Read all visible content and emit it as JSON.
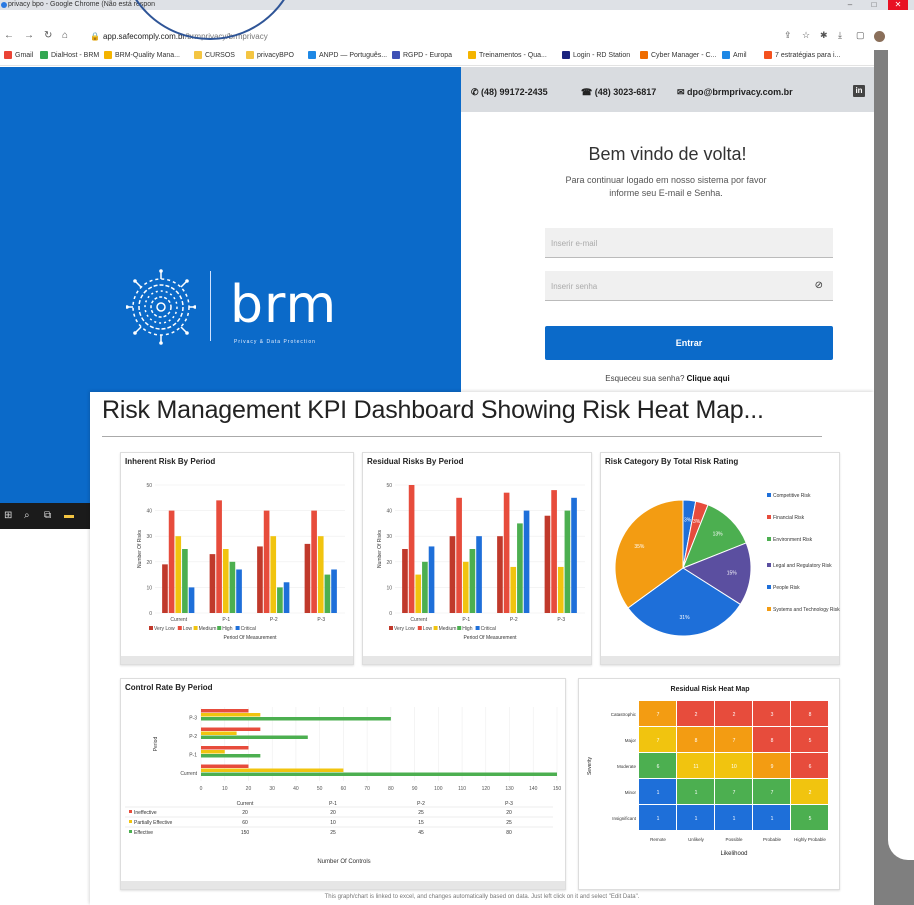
{
  "browser": {
    "window_title": "privacy bpo - Google Chrome (Não está respon",
    "url_host": "app.safecomply.com.br",
    "url_path": "/brmprivacy/brmprivacy",
    "bookmarks": [
      {
        "label": "Gmail",
        "color": "#ea4335"
      },
      {
        "label": "DialHost - BRM",
        "color": "#34a853"
      },
      {
        "label": "BRM-Quality Mana...",
        "color": "#f4b400"
      },
      {
        "label": "CURSOS",
        "color": "#f4c542"
      },
      {
        "label": "privacyBPO",
        "color": "#f4c542"
      },
      {
        "label": "ANPD — Português...",
        "color": "#1e88e5"
      },
      {
        "label": "RGPD - Europa",
        "color": "#3f51b5"
      },
      {
        "label": "Treinamentos - Qua...",
        "color": "#f4b400"
      },
      {
        "label": "Login - RD Station",
        "color": "#1a237e"
      },
      {
        "label": "Cyber Manager - C...",
        "color": "#ef6c00"
      },
      {
        "label": "Amil",
        "color": "#1e88e5"
      },
      {
        "label": "7 estratégias para i...",
        "color": "#f4511e"
      }
    ]
  },
  "brand": {
    "name": "brm",
    "tagline": "Privacy & Data Protection",
    "primary_color": "#0b6ac9"
  },
  "contact": {
    "whatsapp": "(48) 99172-2435",
    "phone": "(48) 3023-6817",
    "email": "dpo@brmprivacy.com.br",
    "linkedin": "in"
  },
  "login": {
    "welcome": "Bem vindo de volta!",
    "subtitle": "Para continuar logado em nosso sistema por favor informe seu E-mail e Senha.",
    "email_placeholder": "Inserir e-mail",
    "password_placeholder": "Inserir senha",
    "submit_label": "Entrar",
    "forgot_text": "Esqueceu sua senha?",
    "forgot_link": "Clique aqui"
  },
  "dashboard": {
    "title": "Risk Management KPI Dashboard Showing Risk Heat Map...",
    "footer": "This graph/chart is linked to excel, and changes automatically based on data. Just left click on it and select \"Edit Data\"."
  },
  "chart_data": [
    {
      "type": "bar",
      "title": "Inherent Risk By Period",
      "xlabel": "Period Of Measurement",
      "ylabel": "Number Of Risks",
      "ylim": [
        0,
        50
      ],
      "categories": [
        "Current",
        "P-1",
        "P-2",
        "P-3"
      ],
      "series": [
        {
          "name": "Very Low",
          "color": "#c0392b",
          "values": [
            19,
            23,
            26,
            27
          ]
        },
        {
          "name": "Low",
          "color": "#e74c3c",
          "values": [
            40,
            44,
            40,
            40
          ]
        },
        {
          "name": "Medium",
          "color": "#f1c40f",
          "values": [
            30,
            25,
            30,
            30
          ]
        },
        {
          "name": "High",
          "color": "#4caf50",
          "values": [
            25,
            20,
            10,
            15
          ]
        },
        {
          "name": "Critical",
          "color": "#1e6fd9",
          "values": [
            10,
            17,
            12,
            17
          ]
        }
      ]
    },
    {
      "type": "bar",
      "title": "Residual Risks By Period",
      "xlabel": "Period Of Measurement",
      "ylabel": "Number Of Risks",
      "ylim": [
        0,
        50
      ],
      "categories": [
        "Current",
        "P-1",
        "P-2",
        "P-3"
      ],
      "series": [
        {
          "name": "Very Low",
          "color": "#c0392b",
          "values": [
            25,
            30,
            30,
            38
          ]
        },
        {
          "name": "Low",
          "color": "#e74c3c",
          "values": [
            50,
            45,
            47,
            48
          ]
        },
        {
          "name": "Medium",
          "color": "#f1c40f",
          "values": [
            15,
            20,
            18,
            18
          ]
        },
        {
          "name": "High",
          "color": "#4caf50",
          "values": [
            20,
            25,
            35,
            40
          ]
        },
        {
          "name": "Critical",
          "color": "#1e6fd9",
          "values": [
            26,
            30,
            40,
            45
          ]
        }
      ]
    },
    {
      "type": "pie",
      "title": "Risk Category By Total Risk Rating",
      "labels": [
        "Competitive Risk",
        "Financial Risk",
        "Environment Risk",
        "Legal and Regulatory Risk",
        "People Risk",
        "Systems and Technology Risk"
      ],
      "values": [
        3,
        3,
        13,
        15,
        31,
        35
      ],
      "colors": [
        "#1e6fd9",
        "#e74c3c",
        "#4caf50",
        "#5b4fa0",
        "#1e6fd9",
        "#f39c12"
      ]
    },
    {
      "type": "bar",
      "title": "Control Rate By Period",
      "xlabel": "Number Of Controls",
      "ylabel": "Period",
      "xlim": [
        0,
        150
      ],
      "categories": [
        "Current",
        "P-1",
        "P-2",
        "P-3"
      ],
      "series": [
        {
          "name": "Ineffective",
          "color": "#e74c3c",
          "values": [
            20,
            20,
            25,
            20
          ]
        },
        {
          "name": "Partially Effective",
          "color": "#f1c40f",
          "values": [
            60,
            10,
            15,
            25
          ]
        },
        {
          "name": "Effective",
          "color": "#4caf50",
          "values": [
            150,
            25,
            45,
            80
          ]
        }
      ],
      "table": {
        "columns": [
          "",
          "Current",
          "P-1",
          "P-2",
          "P-3"
        ],
        "rows": [
          [
            "Ineffective",
            "20",
            "20",
            "25",
            "20"
          ],
          [
            "Partially Effective",
            "60",
            "10",
            "15",
            "25"
          ],
          [
            "Effective",
            "150",
            "25",
            "45",
            "80"
          ]
        ]
      }
    },
    {
      "type": "heatmap",
      "title": "Residual Risk Heat Map",
      "xlabel": "Likelihood",
      "ylabel": "Severity",
      "x_labels": [
        "Remote",
        "Unlikely",
        "Possible",
        "Probable",
        "Highly Probable"
      ],
      "y_labels": [
        "Catastrophic",
        "Major",
        "Moderate",
        "Minor",
        "Insignificant"
      ],
      "cells": [
        [
          {
            "v": "7",
            "c": "#f39c12"
          },
          {
            "v": "2",
            "c": "#e74c3c"
          },
          {
            "v": "2",
            "c": "#e74c3c"
          },
          {
            "v": "3",
            "c": "#e74c3c"
          },
          {
            "v": "8",
            "c": "#e74c3c"
          }
        ],
        [
          {
            "v": "7",
            "c": "#f1c40f"
          },
          {
            "v": "8",
            "c": "#f39c12"
          },
          {
            "v": "7",
            "c": "#f39c12"
          },
          {
            "v": "8",
            "c": "#e74c3c"
          },
          {
            "v": "5",
            "c": "#e74c3c"
          }
        ],
        [
          {
            "v": "6",
            "c": "#4caf50"
          },
          {
            "v": "11",
            "c": "#f1c40f"
          },
          {
            "v": "10",
            "c": "#f1c40f"
          },
          {
            "v": "9",
            "c": "#f39c12"
          },
          {
            "v": "6",
            "c": "#e74c3c"
          }
        ],
        [
          {
            "v": "1",
            "c": "#1e6fd9"
          },
          {
            "v": "1",
            "c": "#4caf50"
          },
          {
            "v": "7",
            "c": "#4caf50"
          },
          {
            "v": "7",
            "c": "#4caf50"
          },
          {
            "v": "2",
            "c": "#f1c40f"
          }
        ],
        [
          {
            "v": "1",
            "c": "#1e6fd9"
          },
          {
            "v": "1",
            "c": "#1e6fd9"
          },
          {
            "v": "1",
            "c": "#1e6fd9"
          },
          {
            "v": "1",
            "c": "#1e6fd9"
          },
          {
            "v": "5",
            "c": "#4caf50"
          }
        ]
      ]
    }
  ]
}
